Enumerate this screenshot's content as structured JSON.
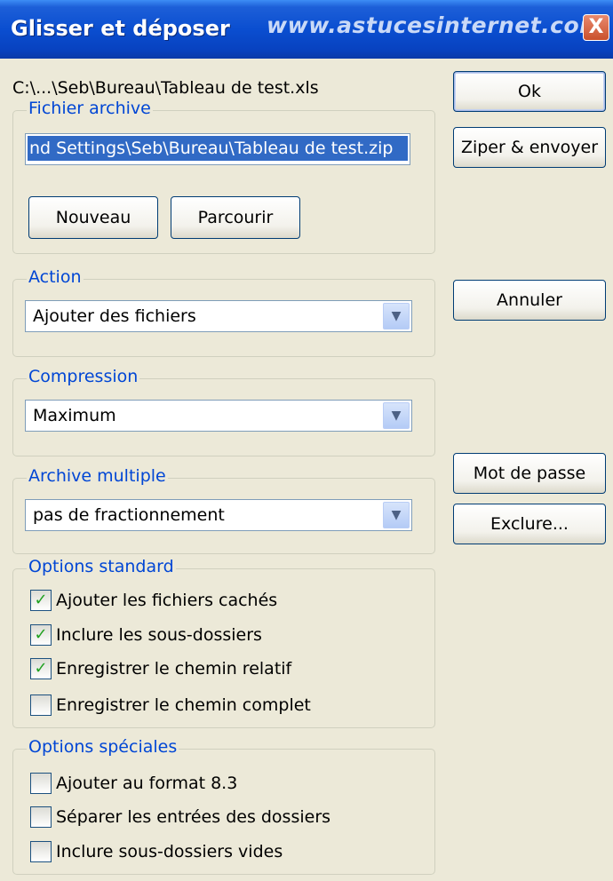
{
  "window": {
    "title": "Glisser et déposer",
    "watermark": "www.astucesinternet.com",
    "close_glyph": "X"
  },
  "source_path": "C:\\...\\Seb\\Bureau\\Tableau de test.xls",
  "archive": {
    "legend": "Fichier archive",
    "path_value": "nd Settings\\Seb\\Bureau\\Tableau de test.zip",
    "new_label": "Nouveau",
    "browse_label": "Parcourir"
  },
  "action": {
    "legend": "Action",
    "selected": "Ajouter des fichiers"
  },
  "compression": {
    "legend": "Compression",
    "selected": "Maximum"
  },
  "multi_archive": {
    "legend": "Archive multiple",
    "selected": "pas de fractionnement"
  },
  "standard_options": {
    "legend": "Options standard",
    "items": [
      {
        "label": "Ajouter les fichiers cachés",
        "checked": true
      },
      {
        "label": "Inclure les sous-dossiers",
        "checked": true
      },
      {
        "label": "Enregistrer le chemin relatif",
        "checked": true
      },
      {
        "label": "Enregistrer le chemin complet",
        "checked": false
      }
    ]
  },
  "special_options": {
    "legend": "Options spéciales",
    "items": [
      {
        "label": "Ajouter au format 8.3",
        "checked": false
      },
      {
        "label": "Séparer les entrées des dossiers",
        "checked": false
      },
      {
        "label": "Inclure sous-dossiers vides",
        "checked": false
      }
    ]
  },
  "buttons": {
    "ok": "Ok",
    "zip_send": "Ziper & envoyer",
    "cancel": "Annuler",
    "password": "Mot de passe",
    "exclude": "Exclure..."
  },
  "colors": {
    "titlebar": "#0a4ed0",
    "legend": "#0046d5",
    "selection": "#316ac5",
    "check": "#21a121"
  }
}
